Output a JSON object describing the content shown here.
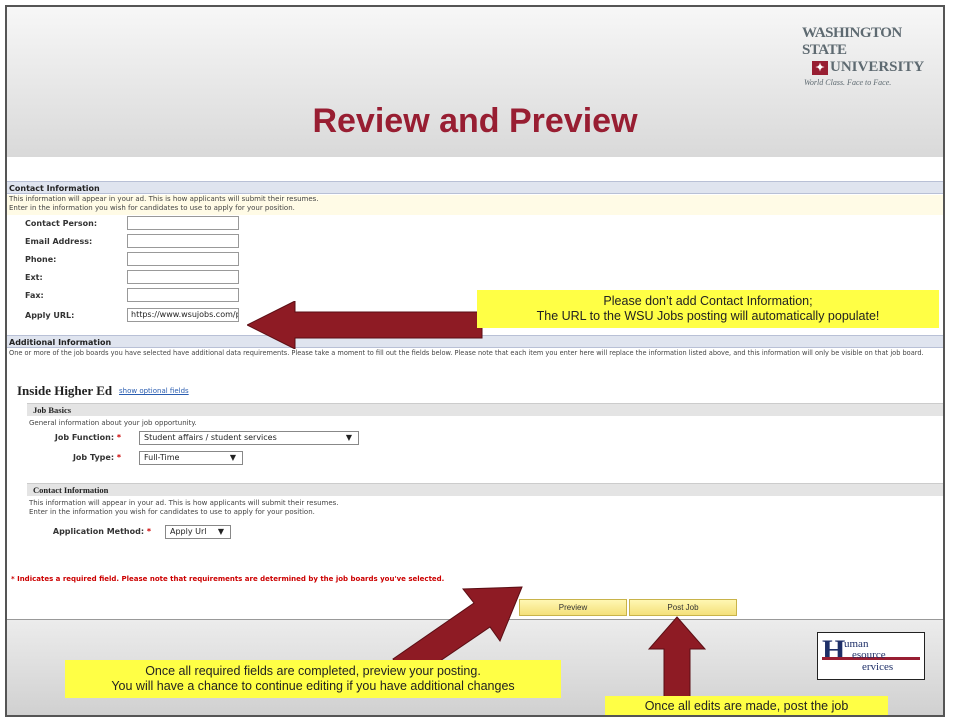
{
  "slide_title": "Review and Preview",
  "wsu_logo": {
    "line1": "WASHINGTON STATE",
    "line2": "UNIVERSITY",
    "line3": "World Class. Face to Face."
  },
  "contact_section": {
    "header": "Contact Information",
    "note_line1": "This information will appear in your ad. This is how applicants will submit their resumes.",
    "note_line2": "Enter in the information you wish for candidates to use to apply for your position.",
    "fields": [
      {
        "label": "Contact Person:",
        "value": ""
      },
      {
        "label": "Email Address:",
        "value": ""
      },
      {
        "label": "Phone:",
        "value": ""
      },
      {
        "label": "Ext:",
        "value": ""
      },
      {
        "label": "Fax:",
        "value": ""
      },
      {
        "label": "Apply URL:",
        "value": "https://www.wsujobs.com/po"
      }
    ]
  },
  "additional_section": {
    "header": "Additional Information",
    "note": "One or more of the job boards you have selected have additional data requirements. Please take a moment to fill out the fields below. Please note that each item you enter here will replace the information listed above, and this information will only be visible on that job board."
  },
  "inside_higher_ed": {
    "title": "Inside Higher Ed",
    "optional_link": "show optional fields",
    "job_basics": {
      "header": "Job Basics",
      "note": "General information about your job opportunity.",
      "job_function_label": "Job Function:",
      "job_function_value": "Student affairs / student services",
      "job_type_label": "Job Type:",
      "job_type_value": "Full-Time"
    },
    "contact": {
      "header": "Contact Information",
      "note_line1": "This information will appear in your ad. This is how applicants will submit their resumes.",
      "note_line2": "Enter in the information you wish for candidates to use to apply for your position.",
      "method_label": "Application Method:",
      "method_value": "Apply Url"
    }
  },
  "required_note": "* Indicates a required field. Please note that requirements are determined by the job boards you've selected.",
  "required_mark": "*",
  "dropdown_arrow": "▼",
  "buttons": {
    "preview": "Preview",
    "post_job": "Post Job"
  },
  "callouts": {
    "contact_line1": "Please don’t add Contact Information;",
    "contact_line2": "The URL to the WSU Jobs posting will automatically populate!",
    "preview_line1": "Once all required fields are completed, preview your posting.",
    "preview_line2": "You will have a chance to continue editing if you have additional changes",
    "post": "Once all edits are made, post the job"
  },
  "hrs_logo": {
    "H": "H",
    "line1": "uman",
    "line2": "esource",
    "line3": "ervices"
  },
  "colors": {
    "wsu_crimson": "#981e32",
    "callout_yellow": "#ffff45",
    "arrow": "#8e1b24",
    "section_bar": "#dfe4ef"
  }
}
